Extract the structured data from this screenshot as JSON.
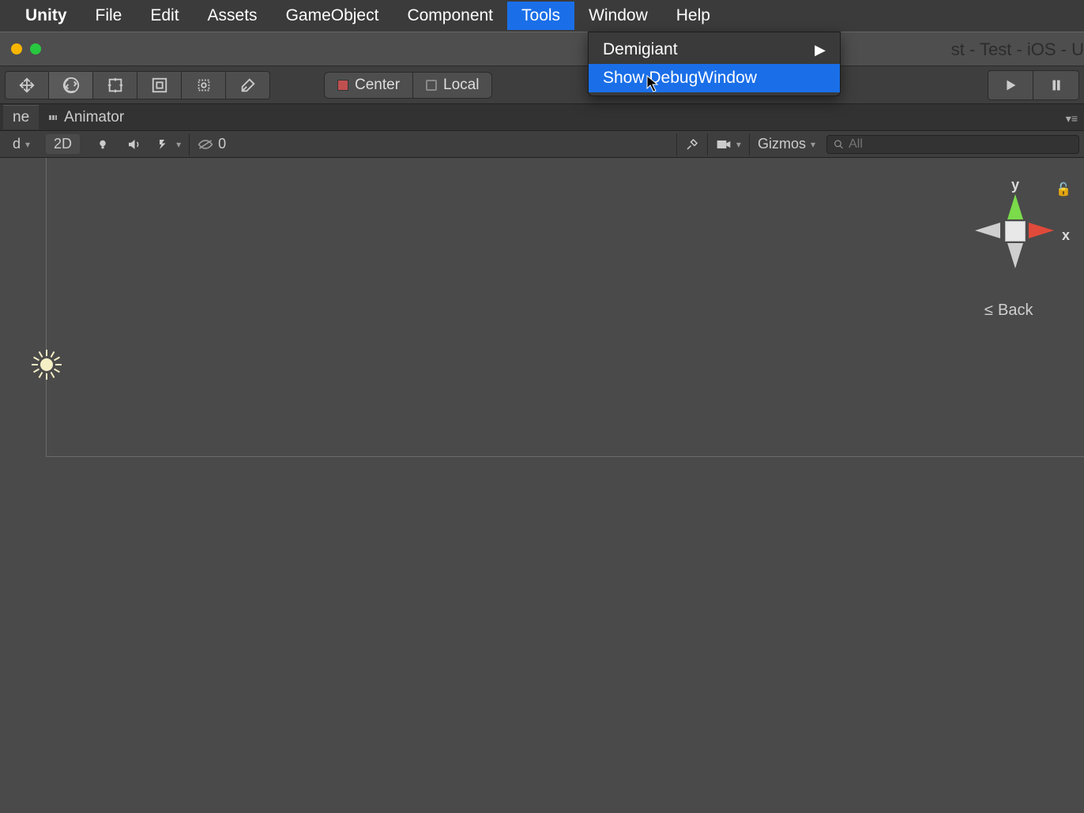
{
  "menubar": {
    "brand": "Unity",
    "items": [
      "File",
      "Edit",
      "Assets",
      "GameObject",
      "Component",
      "Tools",
      "Window",
      "Help"
    ],
    "active": "Tools"
  },
  "dropdown": {
    "items": [
      {
        "label": "Demigiant",
        "submenu": true,
        "highlight": false
      },
      {
        "label": "Show DebugWindow",
        "submenu": false,
        "highlight": true
      }
    ]
  },
  "window_title_suffix": "st - Test - iOS - U",
  "toolbar": {
    "pivot_label": "Center",
    "space_label": "Local"
  },
  "tabs": {
    "scene_partial": "ne",
    "animator": "Animator"
  },
  "scenebar": {
    "shaded_partial": "d",
    "view2d": "2D",
    "hidden_count": "0",
    "gizmos": "Gizmos",
    "search_prefix": "All"
  },
  "gizmo": {
    "y": "y",
    "x": "x",
    "back": "Back"
  }
}
